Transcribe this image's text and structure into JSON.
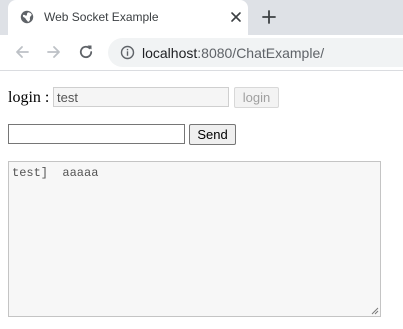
{
  "browser": {
    "tab": {
      "title": "Web Socket Example"
    },
    "address_bar": {
      "host": "localhost",
      "path": ":8080/ChatExample/"
    }
  },
  "page": {
    "login": {
      "label": "login :",
      "value": "test",
      "button_label": "login"
    },
    "message": {
      "value": "",
      "send_label": "Send"
    },
    "chat_log": {
      "text": "test]  aaaaa"
    }
  },
  "icons": {
    "tab_favicon": "globe-icon",
    "tab_close": "close-icon",
    "new_tab": "plus-icon",
    "back": "back-arrow-icon",
    "forward": "forward-arrow-icon",
    "reload": "reload-icon",
    "site_info": "info-icon",
    "resize": "resize-grip-icon"
  },
  "colors": {
    "tabstrip_bg": "#dee1e6",
    "omnibox_bg": "#f1f3f4",
    "disabled_text": "#a0a0a0"
  }
}
